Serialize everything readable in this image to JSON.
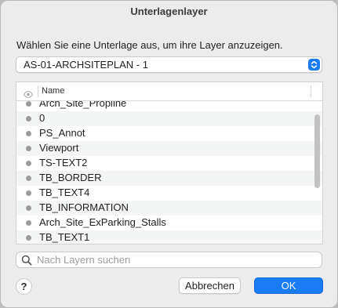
{
  "dialog": {
    "title": "Unterlagenlayer",
    "prompt": "Wählen Sie eine Unterlage aus, um ihre Layer anzuzeigen."
  },
  "underlay_select": {
    "selected": "AS-01-ARCHSITEPLAN - 1",
    "icon": "chevron-updown-icon"
  },
  "table": {
    "visibility_icon": "eye-icon",
    "name_header": "Name",
    "rows": [
      "Arch_Site_Propline",
      "0",
      "PS_Annot",
      "Viewport",
      "TS-TEXT2",
      "TB_BORDER",
      "TB_TEXT4",
      "TB_INFORMATION",
      "Arch_Site_ExParking_Stalls",
      "TB_TEXT1"
    ]
  },
  "search": {
    "placeholder": "Nach Layern suchen",
    "value": ""
  },
  "footer": {
    "help_label": "?",
    "cancel_label": "Abbrechen",
    "ok_label": "OK"
  },
  "colors": {
    "accent": "#1a7cf5",
    "window_bg": "#ececec",
    "row_alt": "#f4f5f5",
    "visibility_dot": "#9b9b9b"
  }
}
